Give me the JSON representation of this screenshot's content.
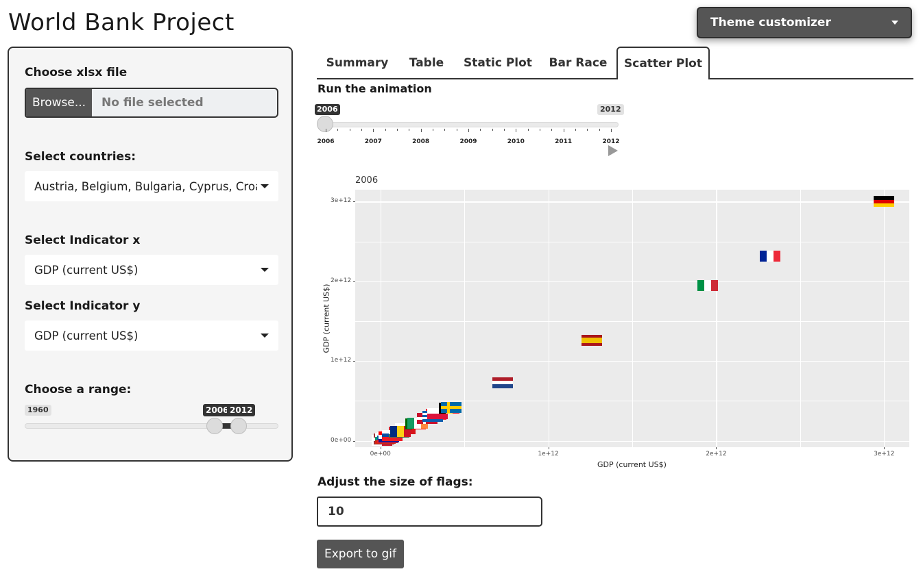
{
  "app": {
    "title": "World Bank Project"
  },
  "theme": {
    "button_label": "Theme customizer"
  },
  "sidebar": {
    "file": {
      "label": "Choose xlsx file",
      "browse_label": "Browse...",
      "placeholder": "No file selected"
    },
    "countries": {
      "label": "Select countries:",
      "value": "Austria, Belgium, Bulgaria, Cyprus, Croatia, Czechia"
    },
    "indicator_x": {
      "label": "Select Indicator x",
      "value": "GDP (current US$)"
    },
    "indicator_y": {
      "label": "Select Indicator y",
      "value": "GDP (current US$)"
    },
    "range": {
      "label": "Choose a range:",
      "min_label": "1960",
      "from_label": "2006",
      "to_label": "2012",
      "min": 1960,
      "max": 2012,
      "from": 2006,
      "to": 2012
    }
  },
  "tabs": [
    {
      "label": "Summary",
      "active": false
    },
    {
      "label": "Table",
      "active": false
    },
    {
      "label": "Static Plot",
      "active": false
    },
    {
      "label": "Bar Race",
      "active": false
    },
    {
      "label": "Scatter Plot",
      "active": true
    }
  ],
  "animation": {
    "label": "Run the animation",
    "current_label": "2006",
    "max_label": "2012",
    "ticks": [
      "2006",
      "2007",
      "2008",
      "2009",
      "2010",
      "2011",
      "2012"
    ],
    "value": 2006,
    "min": 2006,
    "max": 2012
  },
  "chart_data": {
    "type": "scatter",
    "title": "2006",
    "xlabel": "GDP (current US$)",
    "ylabel": "GDP (current US$)",
    "xlim": [
      -150000000000.0,
      3150000000000.0
    ],
    "ylim": [
      -80000000000.0,
      3150000000000.0
    ],
    "x_tick_labels": [
      "0e+00",
      "1e+12",
      "2e+12",
      "3e+12"
    ],
    "y_tick_labels": [
      "0e+00",
      "1e+12",
      "2e+12",
      "3e+12"
    ],
    "grid": true,
    "marker": "flag",
    "points": [
      {
        "flag": "germany",
        "x": 3000000000000.0,
        "y": 3000000000000.0
      },
      {
        "flag": "france",
        "x": 2320000000000.0,
        "y": 2320000000000.0
      },
      {
        "flag": "italy",
        "x": 1950000000000.0,
        "y": 1950000000000.0
      },
      {
        "flag": "spain",
        "x": 1260000000000.0,
        "y": 1260000000000.0
      },
      {
        "flag": "netherlands",
        "x": 730000000000.0,
        "y": 730000000000.0
      },
      {
        "flag": "sweden",
        "x": 420000000000.0,
        "y": 420000000000.0
      },
      {
        "flag": "belgium",
        "x": 410000000000.0,
        "y": 410000000000.0
      },
      {
        "flag": "poland",
        "x": 340000000000.0,
        "y": 340000000000.0
      },
      {
        "flag": "greece",
        "x": 310000000000.0,
        "y": 310000000000.0
      },
      {
        "flag": "austria",
        "x": 330000000000.0,
        "y": 330000000000.0
      },
      {
        "flag": "denmark",
        "x": 280000000000.0,
        "y": 280000000000.0
      },
      {
        "flag": "ireland",
        "x": 220000000000.0,
        "y": 220000000000.0
      },
      {
        "flag": "portugal",
        "x": 210000000000.0,
        "y": 210000000000.0
      },
      {
        "flag": "finland",
        "x": 210000000000.0,
        "y": 210000000000.0
      },
      {
        "flag": "romania",
        "x": 120000000000.0,
        "y": 120000000000.0
      },
      {
        "flag": "czechia",
        "x": 150000000000.0,
        "y": 150000000000.0
      },
      {
        "flag": "hungary",
        "x": 110000000000.0,
        "y": 110000000000.0
      },
      {
        "flag": "slovakia",
        "x": 70000000000.0,
        "y": 70000000000.0
      },
      {
        "flag": "croatia",
        "x": 50000000000.0,
        "y": 50000000000.0
      },
      {
        "flag": "slovenia",
        "x": 40000000000.0,
        "y": 40000000000.0
      },
      {
        "flag": "bulgaria",
        "x": 30000000000.0,
        "y": 30000000000.0
      },
      {
        "flag": "latvia",
        "x": 20000000000.0,
        "y": 20000000000.0
      },
      {
        "flag": "cyprus",
        "x": 20000000000.0,
        "y": 20000000000.0
      },
      {
        "flag": "malta",
        "x": 10000000000.0,
        "y": 10000000000.0
      }
    ]
  },
  "flag_size": {
    "label": "Adjust the size of flags:",
    "value": "10"
  },
  "export": {
    "label": "Export to gif"
  },
  "colors": {
    "primary": "#555555",
    "plot_bg": "#ebebeb",
    "dark_tag": "#333333"
  }
}
